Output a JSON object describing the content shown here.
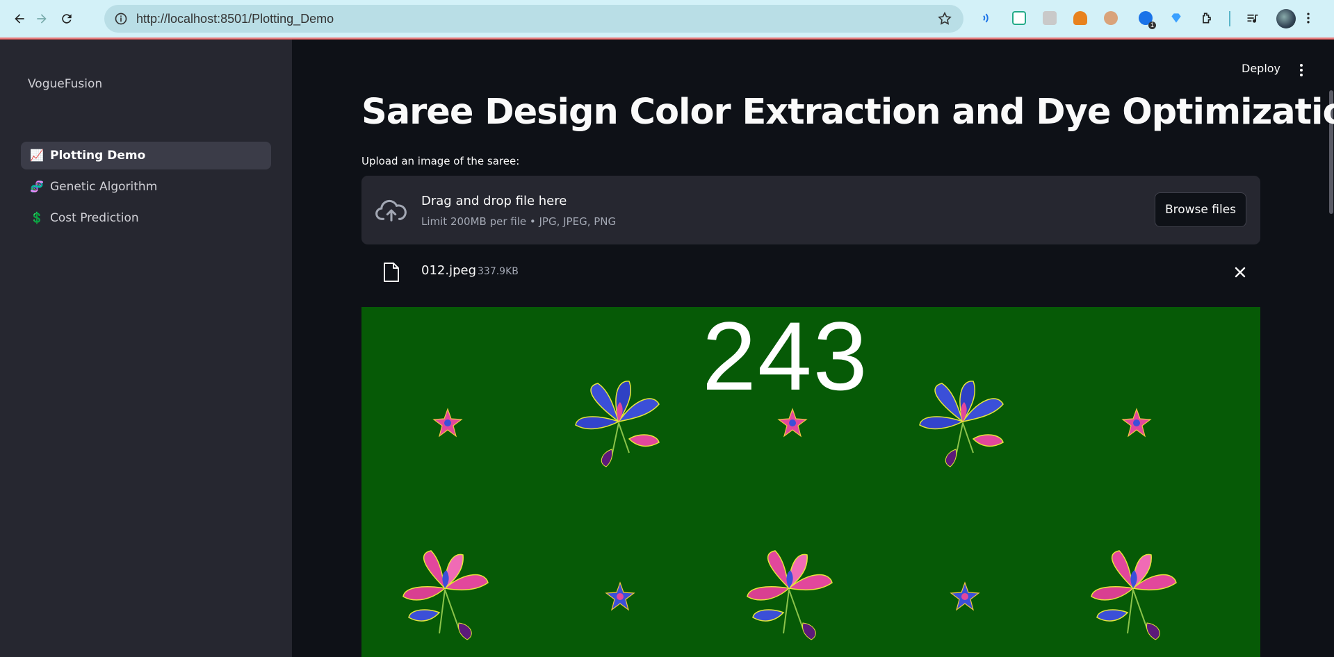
{
  "browser": {
    "url": "http://localhost:8501/Plotting_Demo",
    "ext_badge": "1",
    "icons": [
      "back-icon",
      "forward-icon",
      "reload-icon",
      "site-info-icon",
      "bookmark-star-icon",
      "extensions-icon",
      "media-icon",
      "profile-avatar"
    ]
  },
  "sidebar": {
    "brand": "VogueFusion",
    "items": [
      {
        "emoji": "📈",
        "label": "Plotting Demo",
        "active": true
      },
      {
        "emoji": "🧬",
        "label": "Genetic Algorithm",
        "active": false
      },
      {
        "emoji": "💲",
        "label": "Cost Prediction",
        "active": false
      }
    ]
  },
  "header": {
    "deploy_label": "Deploy"
  },
  "main": {
    "title": "Saree Design Color Extraction and Dye Optimization",
    "upload_label": "Upload an image of the saree:",
    "dropzone": {
      "title": "Drag and drop file here",
      "subtitle": "Limit 200MB per file • JPG, JPEG, PNG",
      "browse_label": "Browse files"
    },
    "file": {
      "name": "012.jpeg",
      "size": "337.9KB"
    },
    "image": {
      "number": "243",
      "background": "#065a06"
    }
  },
  "colors": {
    "sidebar_bg": "#262730",
    "main_bg": "#0e1117",
    "chrome_bg": "#d3f1f8",
    "saree_green": "#065a06",
    "flower_blue": "#3b4fd8",
    "flower_pink": "#e2479c"
  }
}
